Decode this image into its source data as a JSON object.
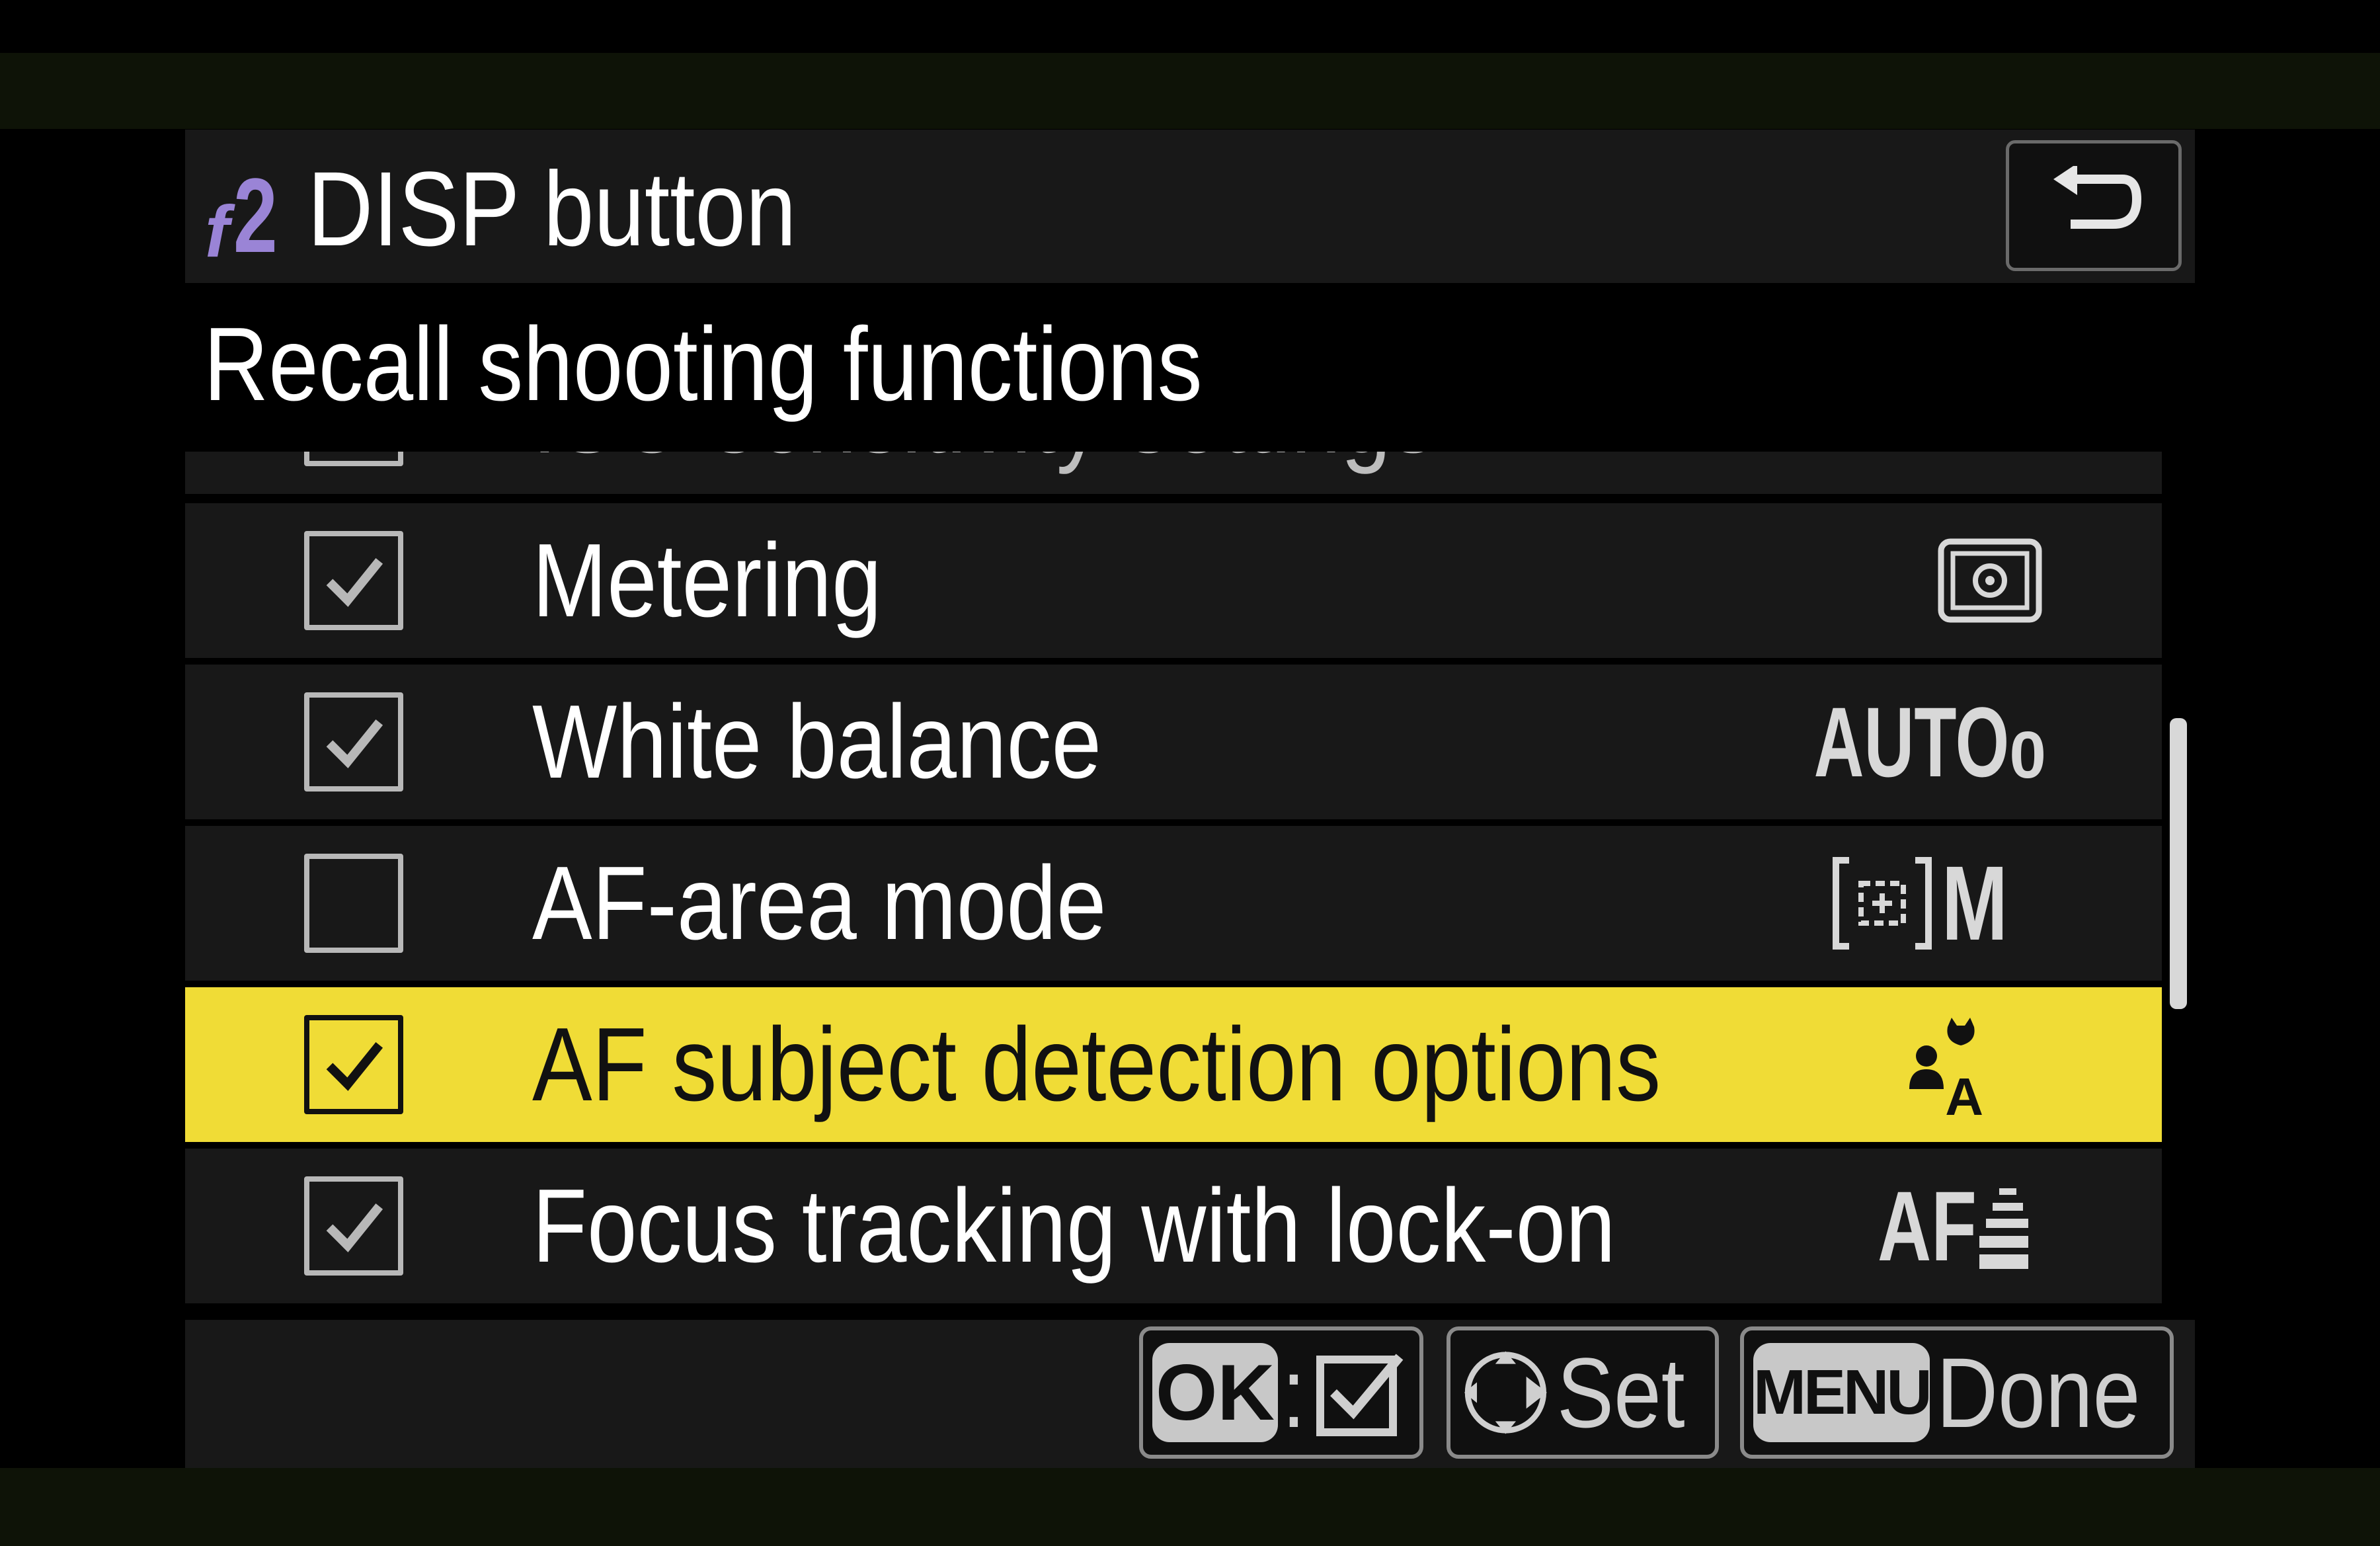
{
  "header": {
    "menu_code_letter": "f",
    "menu_code_number": "2",
    "title": "DISP button",
    "back_icon": "return-arrow-icon"
  },
  "subtitle": "Recall shooting functions",
  "list": {
    "items": [
      {
        "label": "ISO sensitivity settings",
        "checked": false,
        "icon": "iso-icon",
        "partially_visible": true
      },
      {
        "label": "Metering",
        "checked": true,
        "icon": "metering-matrix-icon",
        "icon_text": ""
      },
      {
        "label": "White balance",
        "checked": true,
        "icon": "white-balance-auto-icon",
        "icon_text": "AUTO",
        "icon_subtext": "0"
      },
      {
        "label": "AF-area mode",
        "checked": false,
        "icon": "af-area-icon",
        "icon_text": "M"
      },
      {
        "label": "AF subject detection options",
        "checked": true,
        "selected": true,
        "icon": "subject-detection-icon",
        "icon_text": "A"
      },
      {
        "label": "Focus tracking with lock-on",
        "checked": true,
        "icon": "focus-tracking-icon",
        "icon_text": "AF"
      }
    ]
  },
  "footer": {
    "ok_key": "OK",
    "ok_separator": ":",
    "ok_icon": "checkbox-icon",
    "set_icon": "multi-selector-icon",
    "set_label": "Set",
    "menu_key": "MENU",
    "done_label": "Done"
  },
  "colors": {
    "highlight": "#f0dc36",
    "menu_code": "#9a84d6",
    "row_background": "#181818"
  }
}
